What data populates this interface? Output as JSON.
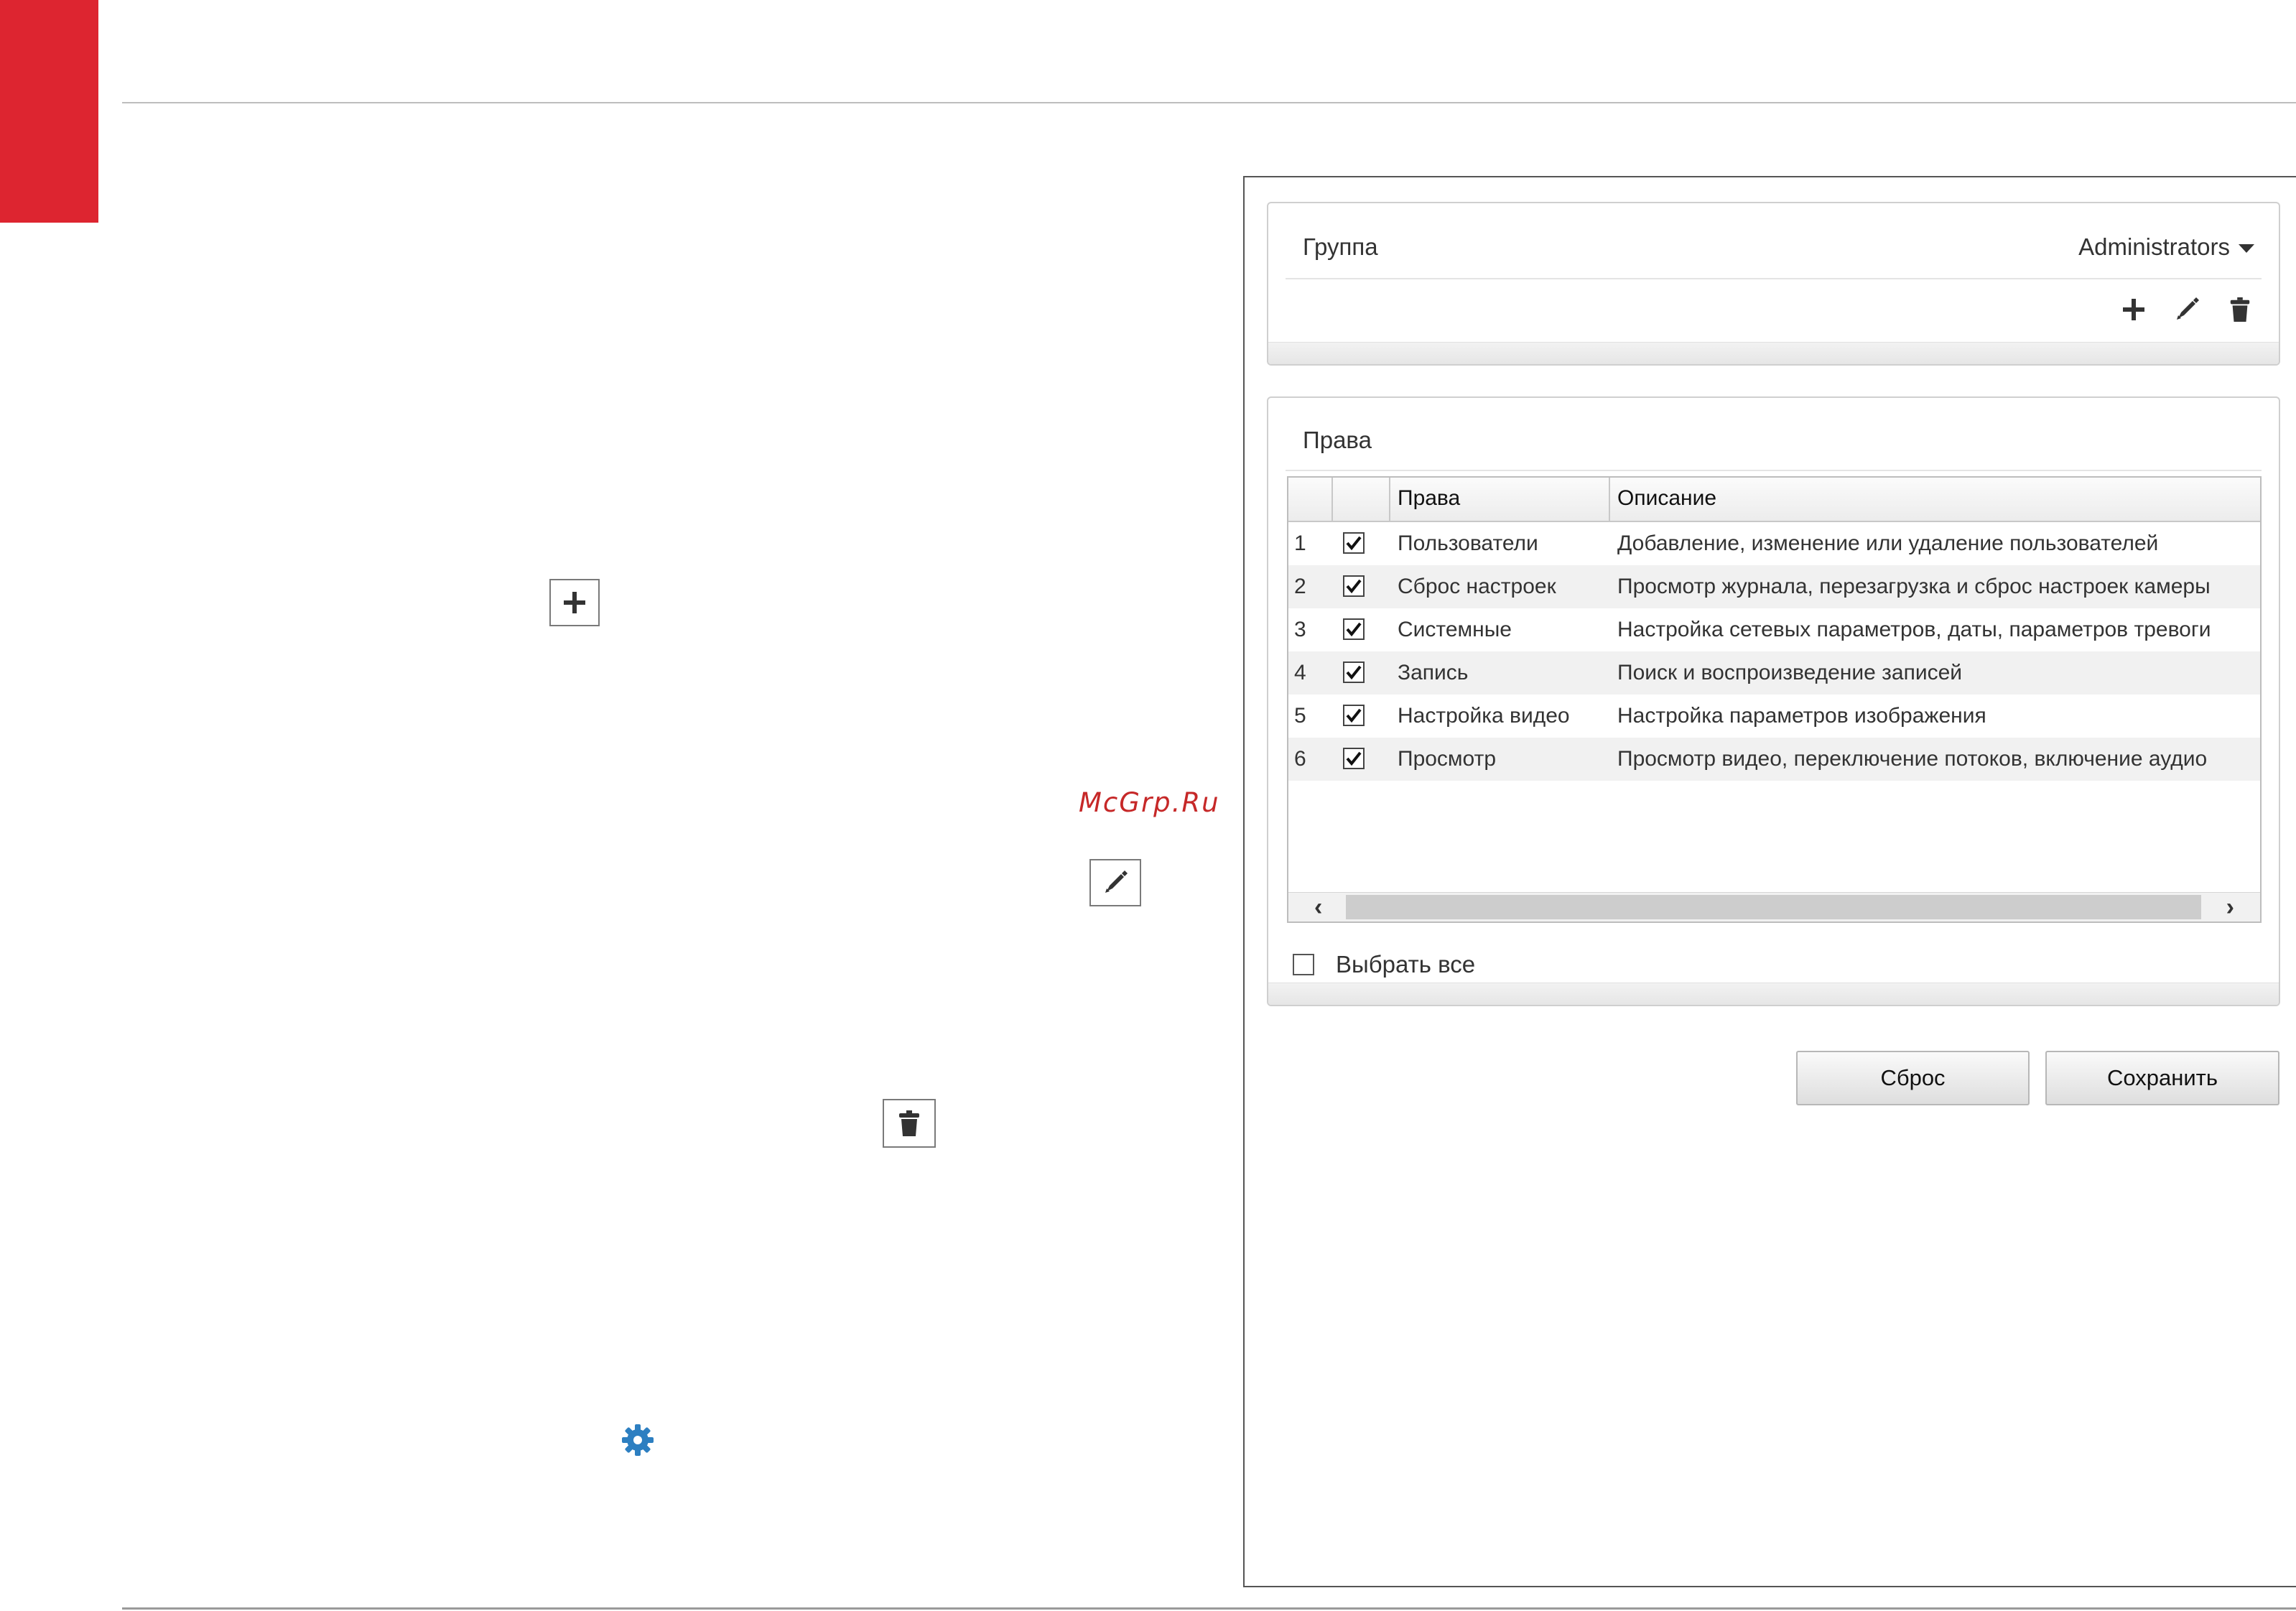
{
  "document": {
    "watermark": "McGrp.Ru",
    "icons": [
      "plus-icon",
      "pencil-icon",
      "trash-icon",
      "gear-icon"
    ],
    "accent_color": "#dd2530"
  },
  "group_panel": {
    "label": "Группа",
    "selected_group": "Administrators",
    "tools": [
      "plus-icon",
      "pencil-icon",
      "trash-icon"
    ]
  },
  "rights_panel": {
    "title": "Права",
    "columns": [
      "",
      "",
      "Права",
      "Описание"
    ],
    "rows": [
      {
        "num": "1",
        "checked": true,
        "right": "Пользователи",
        "description": "Добавление, изменение или удаление пользователей"
      },
      {
        "num": "2",
        "checked": true,
        "right": "Сброс настроек",
        "description": "Просмотр журнала, перезагрузка и сброс настроек камеры"
      },
      {
        "num": "3",
        "checked": true,
        "right": "Системные",
        "description": "Настройка сетевых параметров, даты, параметров тревоги"
      },
      {
        "num": "4",
        "checked": true,
        "right": "Запись",
        "description": "Поиск и воспроизведение записей"
      },
      {
        "num": "5",
        "checked": true,
        "right": "Настройка видео",
        "description": "Настройка параметров изображения"
      },
      {
        "num": "6",
        "checked": true,
        "right": "Просмотр",
        "description": "Просмотр видео, переключение потоков, включение аудио"
      }
    ],
    "select_all_label": "Выбрать все",
    "select_all_checked": false
  },
  "buttons": {
    "reset": "Сброс",
    "save": "Сохранить"
  }
}
